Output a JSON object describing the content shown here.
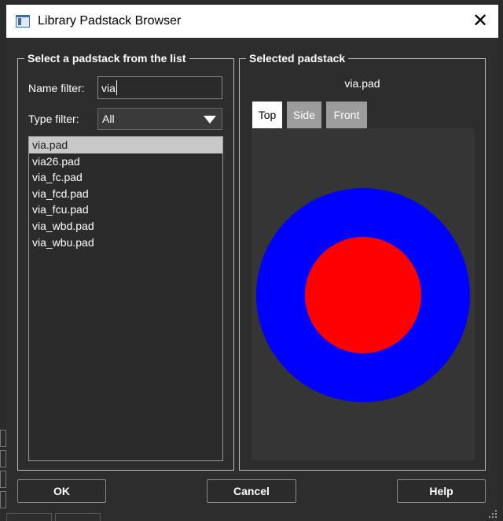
{
  "window": {
    "title": "Library Padstack Browser",
    "close_glyph": "✕"
  },
  "left_group": {
    "legend": "Select a padstack from the list",
    "name_filter_label": "Name filter:",
    "name_filter_value": "via",
    "type_filter_label": "Type filter:",
    "type_filter_value": "All",
    "items": [
      {
        "label": "via.pad",
        "selected": true
      },
      {
        "label": "via26.pad"
      },
      {
        "label": "via_fc.pad"
      },
      {
        "label": "via_fcd.pad"
      },
      {
        "label": "via_fcu.pad"
      },
      {
        "label": "via_wbd.pad"
      },
      {
        "label": "via_wbu.pad"
      }
    ]
  },
  "right_group": {
    "legend": "Selected padstack",
    "padstack_name": "via.pad",
    "tabs": [
      {
        "label": "Top",
        "active": true
      },
      {
        "label": "Side"
      },
      {
        "label": "Front"
      }
    ],
    "preview_colors": {
      "background": "#353535",
      "outer_pad": "#0000ff",
      "inner_drill": "#ff0000"
    }
  },
  "buttons": {
    "ok": "OK",
    "cancel": "Cancel",
    "help": "Help"
  },
  "colors": {
    "dialog_bg": "#2d2d2d",
    "titlebar_bg": "#ffffff",
    "selection_bg": "#c8c8c8"
  }
}
